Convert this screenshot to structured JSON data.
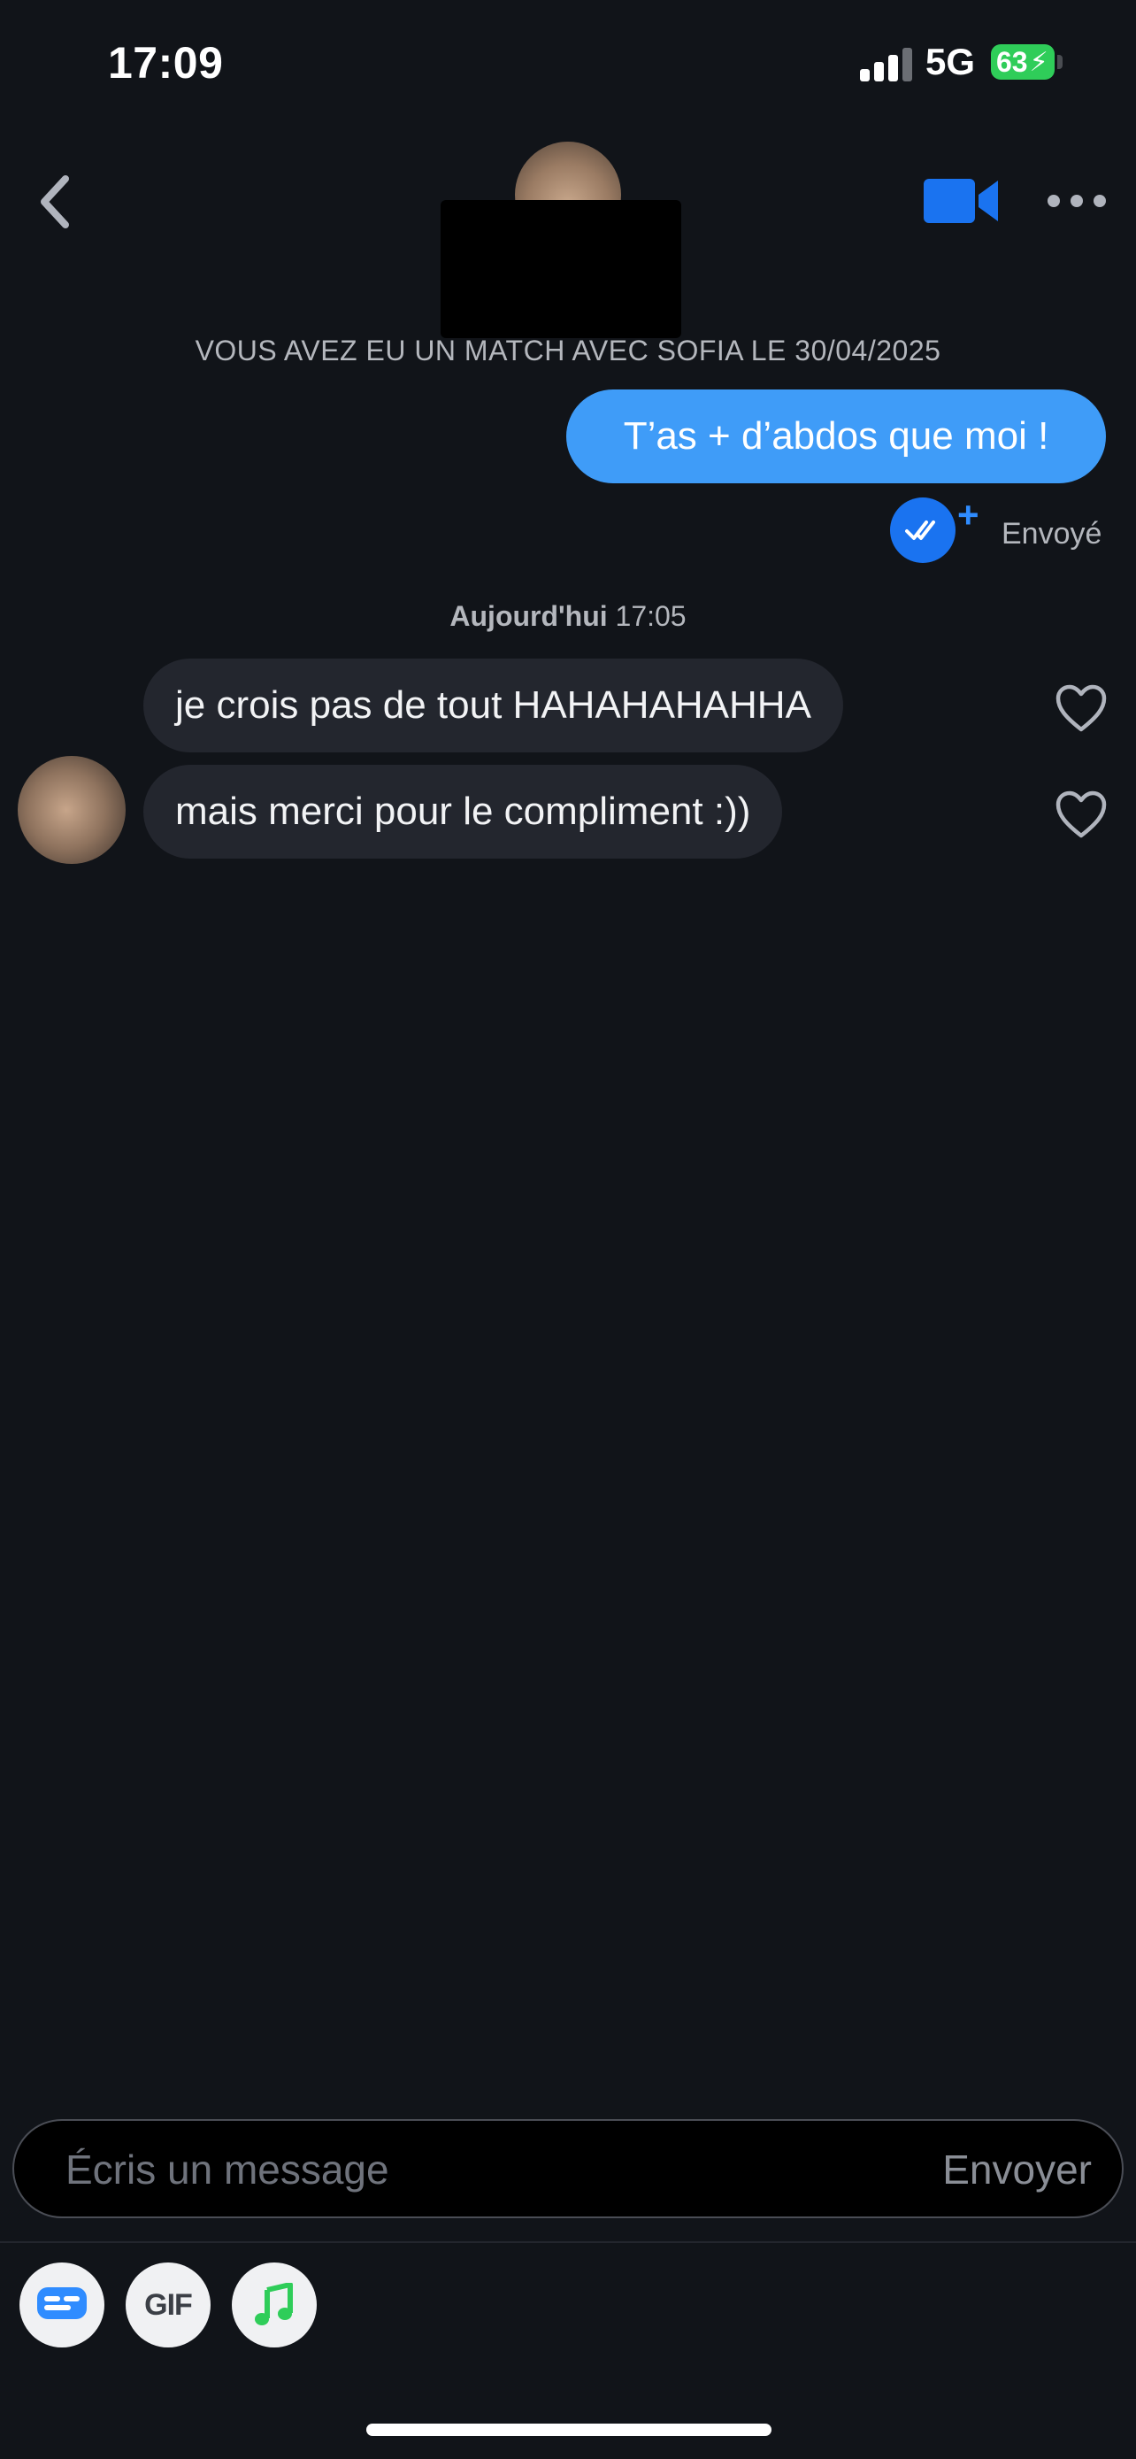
{
  "status_bar": {
    "time": "17:09",
    "network": "5G",
    "battery": "63"
  },
  "header": {
    "back_icon": "chevron-left-icon",
    "video_icon": "video-camera-icon",
    "more_icon": "ellipsis-icon",
    "accent": "#1a73f0"
  },
  "conversation": {
    "match_notice": "VOUS AVEZ EU UN MATCH AVEC SOFIA LE 30/04/2025",
    "sent_messages": [
      {
        "text": "T’as + d’abdos que moi !",
        "status": "Envoyé",
        "status_icon": "double-check-icon",
        "plus": "+"
      }
    ],
    "day_separator": {
      "day": "Aujourd'hui",
      "time": "17:05"
    },
    "received_messages": [
      {
        "text": "je crois pas de tout HAHAHAHAHHA"
      },
      {
        "text": "mais merci pour le compliment :))"
      }
    ],
    "sent_bubble_color": "#3f9cf8",
    "received_bubble_color": "#23262e"
  },
  "composer": {
    "placeholder": "Écris un message",
    "send_label": "Envoyer"
  },
  "toolbar": {
    "sticker_icon": "sticker-icon",
    "gif_label": "GIF",
    "music_icon": "music-note-icon"
  }
}
